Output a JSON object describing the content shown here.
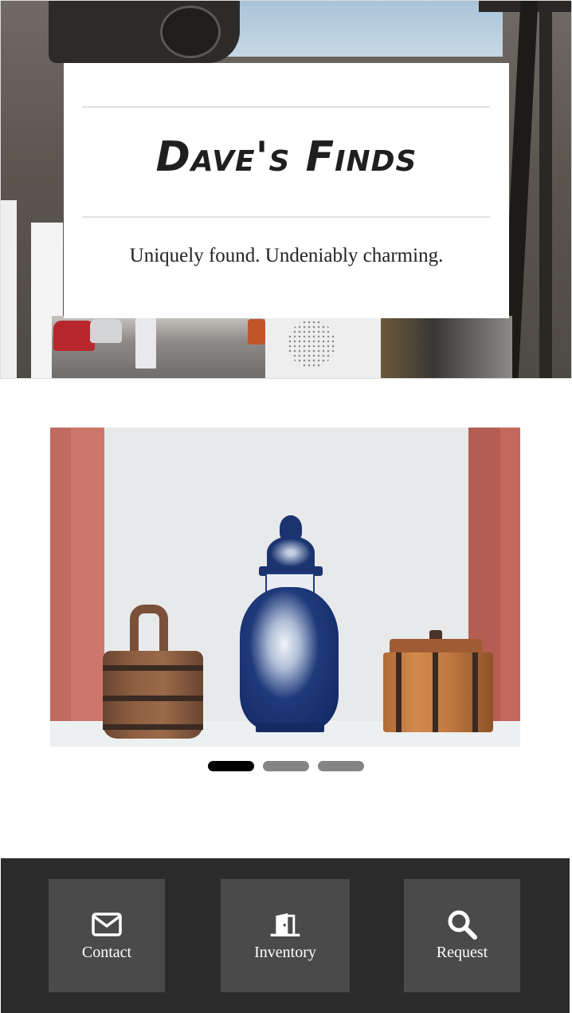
{
  "hero": {
    "title": "Dave's Finds",
    "tagline": "Uniquely found. Undeniably charming."
  },
  "carousel": {
    "slide_count": 3,
    "active_index": 0
  },
  "footer_nav": {
    "items": [
      {
        "label": "Contact",
        "icon": "envelope-icon"
      },
      {
        "label": "Inventory",
        "icon": "door-open-icon"
      },
      {
        "label": "Request",
        "icon": "search-icon"
      }
    ]
  },
  "colors": {
    "footer_bg": "#2b2b2b",
    "tile_bg": "#4a4a4a",
    "dot_active": "#000000",
    "dot_inactive": "#848484"
  }
}
